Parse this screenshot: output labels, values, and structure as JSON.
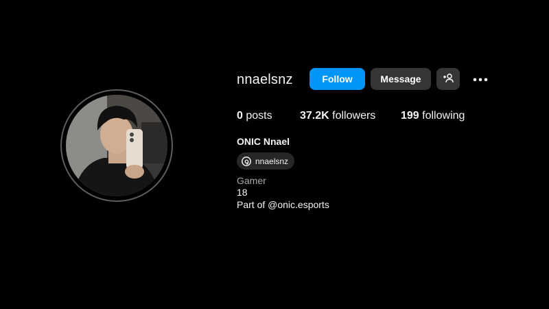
{
  "profile": {
    "username": "nnaelsnz",
    "full_name": "ONIC Nnael",
    "threads_handle": "nnaelsnz",
    "category": "Gamer",
    "bio": [
      "18",
      "Part of @onic.esports"
    ]
  },
  "actions": {
    "follow_label": "Follow",
    "message_label": "Message",
    "add_user_icon": "add-user-icon",
    "more_icon": "more-options-icon"
  },
  "stats": {
    "posts_count": "0",
    "posts_label": "posts",
    "followers_count": "37.2K",
    "followers_label": "followers",
    "following_count": "199",
    "following_label": "following"
  },
  "colors": {
    "background": "#000000",
    "primary_button": "#0095f6",
    "secondary_button": "#363636",
    "muted_text": "#a8a8a8"
  }
}
